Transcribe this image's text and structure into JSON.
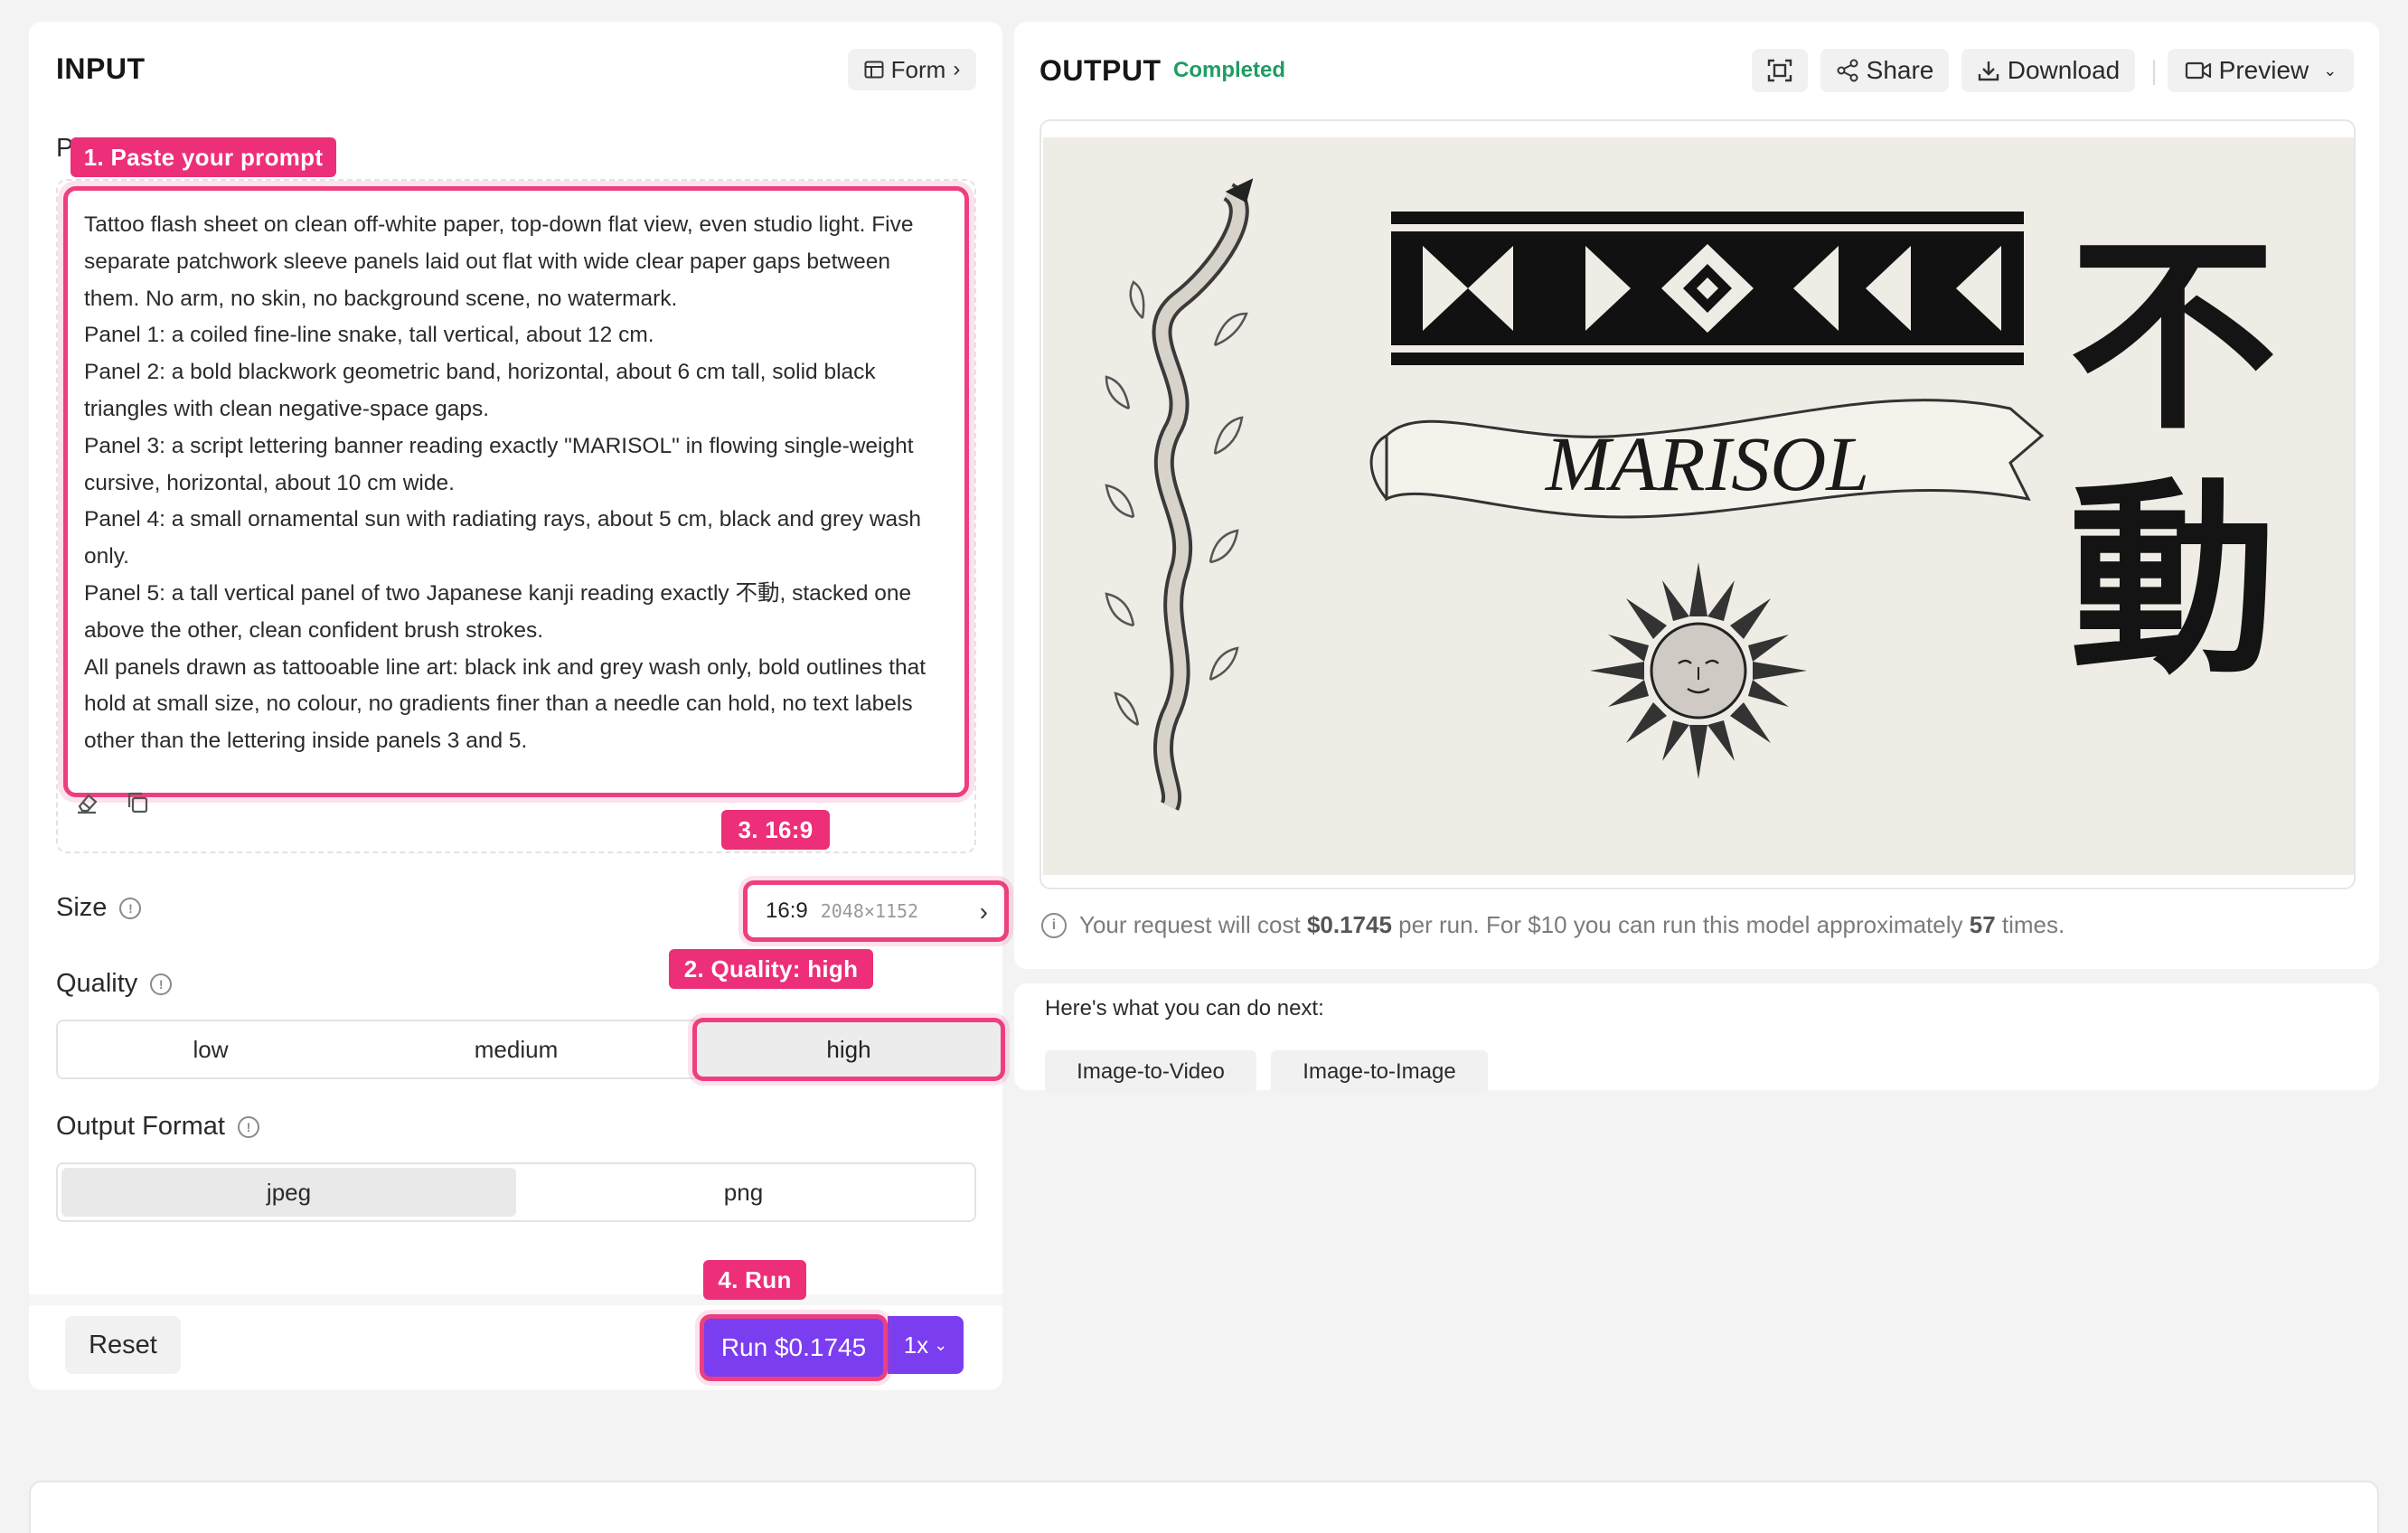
{
  "input": {
    "title": "INPUT",
    "form_button": "Form",
    "prompt_label_partial": "P",
    "prompt_text": "Tattoo flash sheet on clean off-white paper, top-down flat view, even studio light. Five\nseparate patchwork sleeve panels laid out flat with wide clear paper gaps between\nthem. No arm, no skin, no background scene, no watermark.\nPanel 1: a coiled fine-line snake, tall vertical, about 12 cm.\nPanel 2: a bold blackwork geometric band, horizontal, about 6 cm tall, solid black\ntriangles with clean negative-space gaps.\nPanel 3: a script lettering banner reading exactly \"MARISOL\" in flowing single-weight\ncursive, horizontal, about 10 cm wide.\nPanel 4: a small ornamental sun with radiating rays, about 5 cm, black and grey wash\nonly.\nPanel 5: a tall vertical panel of two Japanese kanji reading exactly 不動, stacked one\nabove the other, clean confident brush strokes.\nAll panels drawn as tattooable line art: black ink and grey wash only, bold outlines that\nhold at small size, no colour, no gradients finer than a needle can hold, no text labels\nother than the lettering inside panels 3 and 5.",
    "size_label": "Size",
    "size_value": "16:9",
    "size_dims": "2048×1152",
    "quality_label": "Quality",
    "quality_options": [
      "low",
      "medium",
      "high"
    ],
    "quality_selected": "high",
    "format_label": "Output Format",
    "format_options": [
      "jpeg",
      "png"
    ],
    "format_selected": "jpeg",
    "reset_label": "Reset",
    "run_label": "Run $0.1745",
    "run_multiplier": "1x"
  },
  "annotations": {
    "step1": "1. Paste your prompt",
    "step2": "2. Quality: high",
    "step3": "3. 16:9",
    "step4": "4. Run"
  },
  "output": {
    "title": "OUTPUT",
    "status": "Completed",
    "share_label": "Share",
    "download_label": "Download",
    "preview_label": "Preview",
    "cost_prefix": "Your request will cost",
    "cost_value": "$0.1745",
    "cost_mid": "per run. For $10 you can run this model approximately",
    "cost_count": "57",
    "cost_suffix": "times.",
    "image": {
      "banner_text": "MARISOL",
      "kanji_top": "不",
      "kanji_bottom": "動"
    }
  },
  "next": {
    "heading": "Here's what you can do next:",
    "options": [
      "Image-to-Video",
      "Image-to-Image"
    ]
  },
  "colors": {
    "accent_pink": "#ec2f78",
    "run_purple": "#7b3df0",
    "status_green": "#1f9d62"
  }
}
